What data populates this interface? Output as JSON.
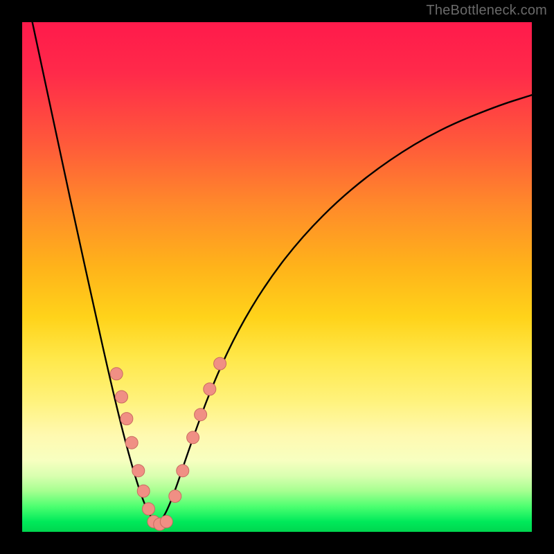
{
  "watermark": "TheBottleneck.com",
  "colors": {
    "page_bg": "#000000",
    "curve": "#000000",
    "marker_fill": "#f08f84",
    "marker_stroke": "#c86b60",
    "gradient_stops": [
      "#ff1a4b",
      "#ff2a4a",
      "#ff5a3a",
      "#ff8a2a",
      "#ffb31a",
      "#ffd31a",
      "#ffe84a",
      "#fff27a",
      "#fff9b0",
      "#f7ffc0",
      "#d9ffb0",
      "#a6ff90",
      "#4dff70",
      "#00e95a",
      "#00d64f"
    ]
  },
  "chart_data": {
    "type": "line",
    "title": "",
    "xlabel": "",
    "ylabel": "",
    "xlim": [
      0,
      1
    ],
    "ylim": [
      0,
      1
    ],
    "note": "x and y are normalized 0–1 fractions of the plot area (origin at top-left of the colored panel, y increases downward as drawn). The V-shaped curve bottoms out near x≈0.27.",
    "series": [
      {
        "name": "curve",
        "x": [
          0.02,
          0.05,
          0.08,
          0.11,
          0.14,
          0.17,
          0.2,
          0.23,
          0.25,
          0.265,
          0.28,
          0.3,
          0.33,
          0.37,
          0.42,
          0.48,
          0.55,
          0.63,
          0.72,
          0.82,
          0.93,
          1.0
        ],
        "y": [
          0.0,
          0.14,
          0.28,
          0.42,
          0.555,
          0.69,
          0.815,
          0.92,
          0.968,
          0.985,
          0.968,
          0.92,
          0.83,
          0.72,
          0.61,
          0.51,
          0.42,
          0.34,
          0.27,
          0.21,
          0.165,
          0.143
        ]
      },
      {
        "name": "markers-left",
        "x": [
          0.185,
          0.195,
          0.205,
          0.215,
          0.228,
          0.238,
          0.248
        ],
        "y": [
          0.69,
          0.735,
          0.778,
          0.825,
          0.88,
          0.92,
          0.955
        ]
      },
      {
        "name": "markers-bottom",
        "x": [
          0.258,
          0.27,
          0.283
        ],
        "y": [
          0.98,
          0.985,
          0.98
        ]
      },
      {
        "name": "markers-right",
        "x": [
          0.3,
          0.315,
          0.335,
          0.35,
          0.368,
          0.388
        ],
        "y": [
          0.93,
          0.88,
          0.815,
          0.77,
          0.72,
          0.67
        ]
      }
    ]
  }
}
